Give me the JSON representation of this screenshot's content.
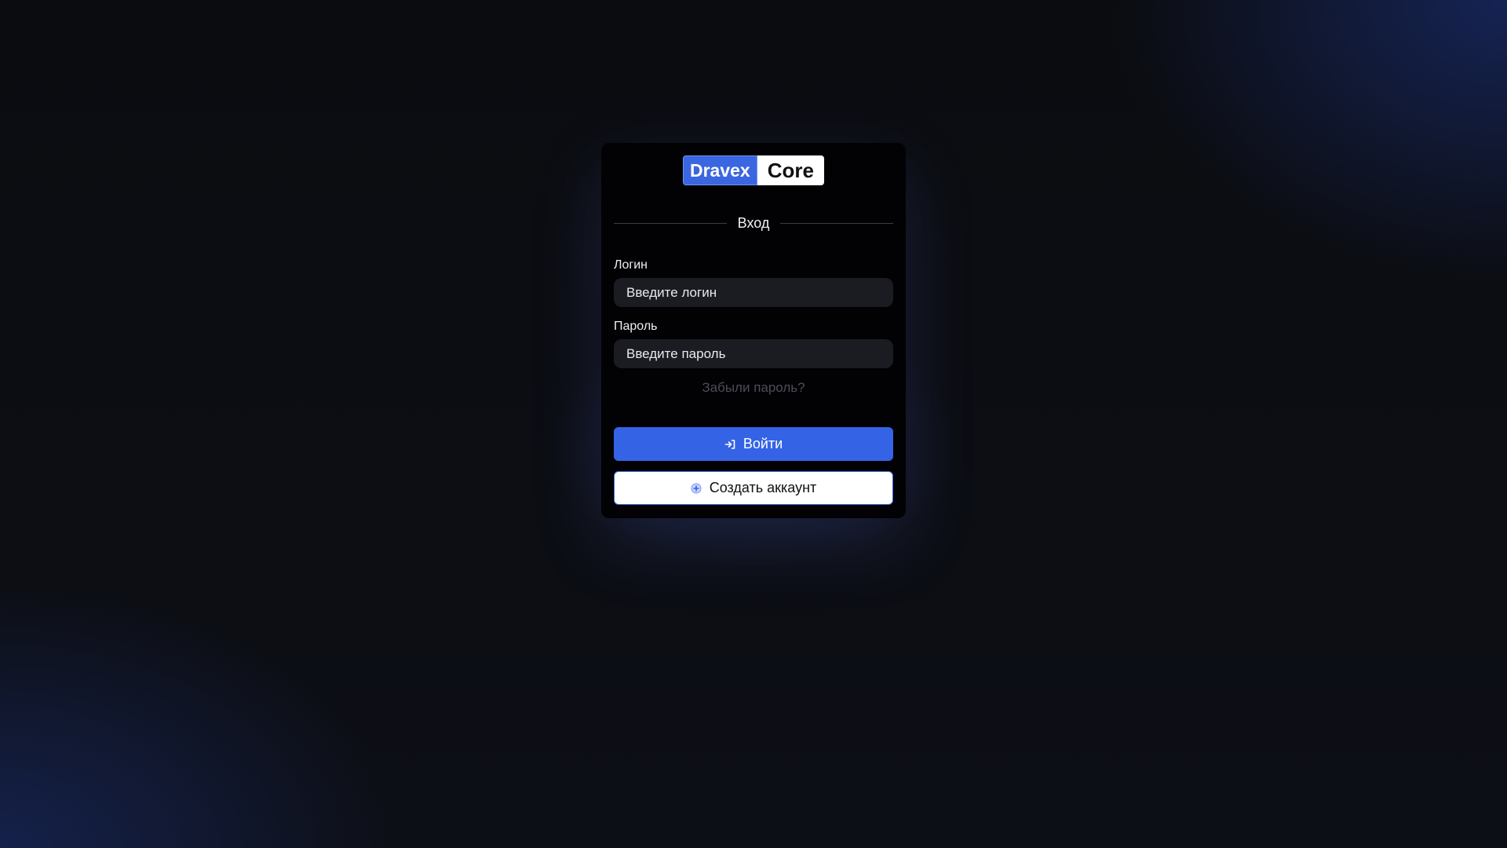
{
  "brand": {
    "part_a": "Dravex",
    "part_b": "Core",
    "accent_color": "#3463e6"
  },
  "form": {
    "title": "Вход",
    "login": {
      "label": "Логин",
      "placeholder": "Введите логин",
      "value": ""
    },
    "password": {
      "label": "Пароль",
      "placeholder": "Введите пароль",
      "value": ""
    },
    "forgot_label": "Забыли пароль?",
    "login_button": {
      "label": "Войти",
      "icon": "login-arrow-icon"
    },
    "register_button": {
      "label": "Создать аккаунт",
      "icon": "plus-circle-icon"
    }
  }
}
